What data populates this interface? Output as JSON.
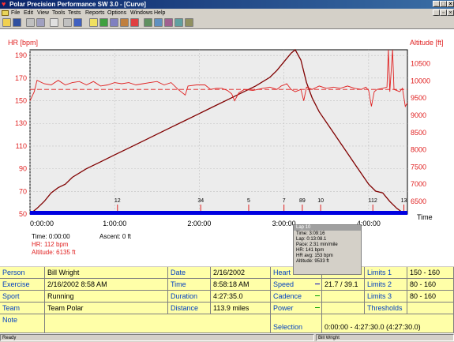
{
  "window": {
    "title": "Polar Precision Performance SW 3.0 - [Curve]"
  },
  "menu": [
    "File",
    "Edit",
    "View",
    "Tools",
    "Tests",
    "Reports",
    "Options",
    "Windows",
    "Help"
  ],
  "chart_data": {
    "type": "line",
    "title": "",
    "left_axis": {
      "label": "HR [bpm]",
      "ticks": [
        50,
        70,
        90,
        110,
        130,
        150,
        170,
        190
      ],
      "range": [
        50,
        195
      ]
    },
    "right_axis": {
      "label": "Altitude [ft]",
      "ticks": [
        6500,
        7000,
        7500,
        8000,
        8500,
        9000,
        9500,
        10000,
        10500
      ],
      "range": [
        6135,
        10900
      ]
    },
    "x_axis": {
      "label": "Time",
      "ticks": [
        "0:00:00",
        "1:00:00",
        "2:00:00",
        "3:00:00",
        "4:00:00"
      ],
      "range_minutes": [
        0,
        267.5
      ]
    },
    "hr_limit": 160,
    "series": [
      {
        "name": "HR",
        "color": "#e02020",
        "points_min_bpm": [
          [
            0,
            150
          ],
          [
            3,
            158
          ],
          [
            5,
            168
          ],
          [
            10,
            165
          ],
          [
            15,
            164
          ],
          [
            20,
            168
          ],
          [
            25,
            164
          ],
          [
            30,
            166
          ],
          [
            35,
            167
          ],
          [
            40,
            164
          ],
          [
            45,
            167
          ],
          [
            50,
            163
          ],
          [
            55,
            164
          ],
          [
            60,
            166
          ],
          [
            65,
            165
          ],
          [
            70,
            166
          ],
          [
            75,
            164
          ],
          [
            80,
            165
          ],
          [
            85,
            166
          ],
          [
            90,
            167
          ],
          [
            95,
            164
          ],
          [
            100,
            166
          ],
          [
            105,
            160
          ],
          [
            110,
            155
          ],
          [
            112,
            163
          ],
          [
            118,
            164
          ],
          [
            124,
            164
          ],
          [
            128,
            160
          ],
          [
            132,
            161
          ],
          [
            136,
            161
          ],
          [
            140,
            159
          ],
          [
            143,
            156
          ],
          [
            145,
            150
          ],
          [
            148,
            157
          ],
          [
            152,
            160
          ],
          [
            158,
            159
          ],
          [
            165,
            161
          ],
          [
            170,
            162
          ],
          [
            175,
            160
          ],
          [
            178,
            163
          ],
          [
            182,
            165
          ],
          [
            185,
            160
          ],
          [
            188,
            158
          ],
          [
            192,
            160
          ],
          [
            194,
            150
          ],
          [
            196,
            162
          ],
          [
            200,
            160
          ],
          [
            205,
            163
          ],
          [
            210,
            161
          ],
          [
            215,
            162
          ],
          [
            220,
            161
          ],
          [
            225,
            163
          ],
          [
            230,
            161
          ],
          [
            235,
            160
          ],
          [
            238,
            162
          ],
          [
            240,
            159
          ],
          [
            242,
            145
          ],
          [
            244,
            158
          ],
          [
            246,
            160
          ],
          [
            250,
            161
          ],
          [
            253,
            162
          ],
          [
            254,
            195
          ],
          [
            255,
            158
          ],
          [
            257,
            195
          ],
          [
            258,
            160
          ],
          [
            262,
            158
          ],
          [
            264,
            161
          ],
          [
            266,
            145
          ],
          [
            267.5,
            148
          ]
        ]
      },
      {
        "name": "Altitude",
        "color": "#800000",
        "points_min_ft": [
          [
            0,
            6135
          ],
          [
            5,
            6300
          ],
          [
            10,
            6500
          ],
          [
            15,
            6750
          ],
          [
            20,
            6900
          ],
          [
            25,
            7000
          ],
          [
            30,
            7200
          ],
          [
            40,
            7450
          ],
          [
            50,
            7650
          ],
          [
            60,
            7850
          ],
          [
            70,
            8050
          ],
          [
            80,
            8250
          ],
          [
            90,
            8450
          ],
          [
            100,
            8650
          ],
          [
            110,
            8850
          ],
          [
            120,
            9050
          ],
          [
            130,
            9250
          ],
          [
            140,
            9450
          ],
          [
            150,
            9650
          ],
          [
            160,
            9850
          ],
          [
            170,
            10100
          ],
          [
            175,
            10300
          ],
          [
            180,
            10550
          ],
          [
            185,
            10800
          ],
          [
            188,
            10900
          ],
          [
            192,
            10600
          ],
          [
            196,
            9950
          ],
          [
            200,
            9500
          ],
          [
            205,
            9100
          ],
          [
            210,
            8800
          ],
          [
            215,
            8500
          ],
          [
            220,
            8200
          ],
          [
            225,
            7900
          ],
          [
            230,
            7600
          ],
          [
            235,
            7300
          ],
          [
            240,
            7000
          ],
          [
            245,
            6800
          ],
          [
            250,
            6750
          ],
          [
            255,
            6500
          ],
          [
            260,
            6300
          ],
          [
            264,
            6180
          ],
          [
            267.5,
            6135
          ]
        ]
      }
    ],
    "lap_markers": [
      {
        "label": "12",
        "minute": 62
      },
      {
        "label": "34",
        "minute": 121
      },
      {
        "label": "5",
        "minute": 155
      },
      {
        "label": "7",
        "minute": 180
      },
      {
        "label": "89",
        "minute": 193
      },
      {
        "label": "10",
        "minute": 206
      },
      {
        "label": "112",
        "minute": 243
      },
      {
        "label": "13",
        "minute": 265
      }
    ]
  },
  "cursor_readout": {
    "time": "Time: 0:00:00",
    "ascent": "Ascent: 0 ft",
    "hr": "HR: 112 bpm",
    "altitude": "Altitude: 6135 ft"
  },
  "lap_tooltip": {
    "title": "Lap 10",
    "lines": [
      "Time: 3:09:16",
      "Lap: 0:13:08.1",
      "Pace: 2:31 min/mile",
      "HR: 141 bpm",
      "HR avg: 153 bpm",
      "Altitude: 9533 ft"
    ]
  },
  "summary": {
    "person_label": "Person",
    "person": "Bill Wright",
    "exercise_label": "Exercise",
    "exercise": "2/16/2002 8:58 AM",
    "sport_label": "Sport",
    "sport": "Running",
    "team_label": "Team",
    "team": "Team Polar",
    "note_label": "Note",
    "date_label": "Date",
    "date": "2/16/2002",
    "time_label": "Time",
    "time": "8:58:18 AM",
    "duration_label": "Duration",
    "duration": "4:27:35.0",
    "distance_label": "Distance",
    "distance": "113.9 miles",
    "heart_label": "Heart r",
    "speed_label": "Speed",
    "speed": "21.7 / 39.1",
    "cadence_label": "Cadence",
    "power_label": "Power",
    "selection_label": "Selection",
    "selection": "0:00:00 - 4:27:30.0 (4:27:30.0)",
    "limits1_label": "Limits 1",
    "limits1": "150 - 160",
    "limits2_label": "Limits 2",
    "limits2": "80 - 160",
    "limits3_label": "Limits 3",
    "limits3": "80 - 160",
    "thresholds_label": "Thresholds"
  },
  "status": {
    "left": "Ready",
    "user": "Bill Wright"
  },
  "colors": {
    "hr": "#e02020",
    "altitude": "#800000",
    "laps_bar": "#0000e0",
    "table_bg": "#ffffa8",
    "label_blue": "#003fc0"
  }
}
